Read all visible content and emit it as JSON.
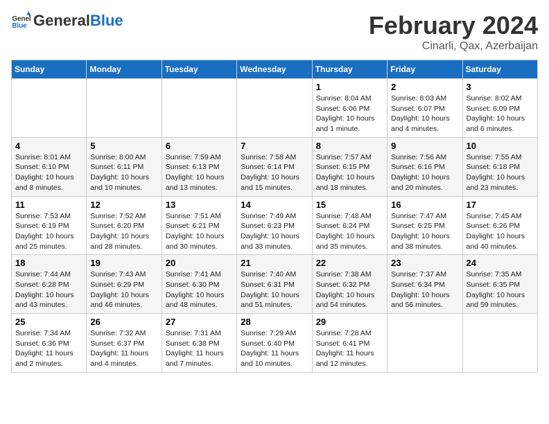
{
  "header": {
    "logo_text_general": "General",
    "logo_text_blue": "Blue",
    "main_title": "February 2024",
    "subtitle": "Cinarli, Qax, Azerbaijan"
  },
  "days_of_week": [
    "Sunday",
    "Monday",
    "Tuesday",
    "Wednesday",
    "Thursday",
    "Friday",
    "Saturday"
  ],
  "weeks": [
    [
      {
        "day": "",
        "info": ""
      },
      {
        "day": "",
        "info": ""
      },
      {
        "day": "",
        "info": ""
      },
      {
        "day": "",
        "info": ""
      },
      {
        "day": "1",
        "info": "Sunrise: 8:04 AM\nSunset: 6:06 PM\nDaylight: 10 hours and 1 minute."
      },
      {
        "day": "2",
        "info": "Sunrise: 8:03 AM\nSunset: 6:07 PM\nDaylight: 10 hours and 4 minutes."
      },
      {
        "day": "3",
        "info": "Sunrise: 8:02 AM\nSunset: 6:09 PM\nDaylight: 10 hours and 6 minutes."
      }
    ],
    [
      {
        "day": "4",
        "info": "Sunrise: 8:01 AM\nSunset: 6:10 PM\nDaylight: 10 hours and 8 minutes."
      },
      {
        "day": "5",
        "info": "Sunrise: 8:00 AM\nSunset: 6:11 PM\nDaylight: 10 hours and 10 minutes."
      },
      {
        "day": "6",
        "info": "Sunrise: 7:59 AM\nSunset: 6:13 PM\nDaylight: 10 hours and 13 minutes."
      },
      {
        "day": "7",
        "info": "Sunrise: 7:58 AM\nSunset: 6:14 PM\nDaylight: 10 hours and 15 minutes."
      },
      {
        "day": "8",
        "info": "Sunrise: 7:57 AM\nSunset: 6:15 PM\nDaylight: 10 hours and 18 minutes."
      },
      {
        "day": "9",
        "info": "Sunrise: 7:56 AM\nSunset: 6:16 PM\nDaylight: 10 hours and 20 minutes."
      },
      {
        "day": "10",
        "info": "Sunrise: 7:55 AM\nSunset: 6:18 PM\nDaylight: 10 hours and 23 minutes."
      }
    ],
    [
      {
        "day": "11",
        "info": "Sunrise: 7:53 AM\nSunset: 6:19 PM\nDaylight: 10 hours and 25 minutes."
      },
      {
        "day": "12",
        "info": "Sunrise: 7:52 AM\nSunset: 6:20 PM\nDaylight: 10 hours and 28 minutes."
      },
      {
        "day": "13",
        "info": "Sunrise: 7:51 AM\nSunset: 6:21 PM\nDaylight: 10 hours and 30 minutes."
      },
      {
        "day": "14",
        "info": "Sunrise: 7:49 AM\nSunset: 6:23 PM\nDaylight: 10 hours and 33 minutes."
      },
      {
        "day": "15",
        "info": "Sunrise: 7:48 AM\nSunset: 6:24 PM\nDaylight: 10 hours and 35 minutes."
      },
      {
        "day": "16",
        "info": "Sunrise: 7:47 AM\nSunset: 6:25 PM\nDaylight: 10 hours and 38 minutes."
      },
      {
        "day": "17",
        "info": "Sunrise: 7:45 AM\nSunset: 6:26 PM\nDaylight: 10 hours and 40 minutes."
      }
    ],
    [
      {
        "day": "18",
        "info": "Sunrise: 7:44 AM\nSunset: 6:28 PM\nDaylight: 10 hours and 43 minutes."
      },
      {
        "day": "19",
        "info": "Sunrise: 7:43 AM\nSunset: 6:29 PM\nDaylight: 10 hours and 46 minutes."
      },
      {
        "day": "20",
        "info": "Sunrise: 7:41 AM\nSunset: 6:30 PM\nDaylight: 10 hours and 48 minutes."
      },
      {
        "day": "21",
        "info": "Sunrise: 7:40 AM\nSunset: 6:31 PM\nDaylight: 10 hours and 51 minutes."
      },
      {
        "day": "22",
        "info": "Sunrise: 7:38 AM\nSunset: 6:32 PM\nDaylight: 10 hours and 54 minutes."
      },
      {
        "day": "23",
        "info": "Sunrise: 7:37 AM\nSunset: 6:34 PM\nDaylight: 10 hours and 56 minutes."
      },
      {
        "day": "24",
        "info": "Sunrise: 7:35 AM\nSunset: 6:35 PM\nDaylight: 10 hours and 59 minutes."
      }
    ],
    [
      {
        "day": "25",
        "info": "Sunrise: 7:34 AM\nSunset: 6:36 PM\nDaylight: 11 hours and 2 minutes."
      },
      {
        "day": "26",
        "info": "Sunrise: 7:32 AM\nSunset: 6:37 PM\nDaylight: 11 hours and 4 minutes."
      },
      {
        "day": "27",
        "info": "Sunrise: 7:31 AM\nSunset: 6:38 PM\nDaylight: 11 hours and 7 minutes."
      },
      {
        "day": "28",
        "info": "Sunrise: 7:29 AM\nSunset: 6:40 PM\nDaylight: 11 hours and 10 minutes."
      },
      {
        "day": "29",
        "info": "Sunrise: 7:28 AM\nSunset: 6:41 PM\nDaylight: 11 hours and 12 minutes."
      },
      {
        "day": "",
        "info": ""
      },
      {
        "day": "",
        "info": ""
      }
    ]
  ]
}
